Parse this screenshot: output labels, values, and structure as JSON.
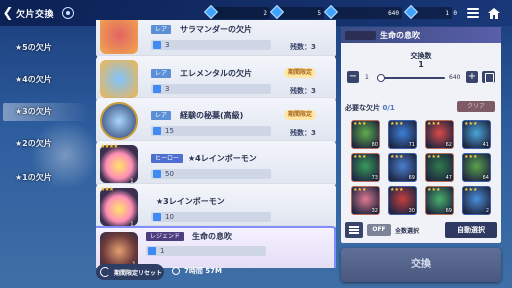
{
  "header": {
    "title": "欠片交換",
    "currencies": [
      "2",
      "5",
      "640",
      "1",
      "0"
    ]
  },
  "sidebar": {
    "items": [
      {
        "label": "★5の欠片",
        "active": false
      },
      {
        "label": "★4の欠片",
        "active": false
      },
      {
        "label": "★3の欠片",
        "active": true
      },
      {
        "label": "★2の欠片",
        "active": false
      },
      {
        "label": "★1の欠片",
        "active": false
      }
    ]
  },
  "list": {
    "items": [
      {
        "rarity": "レア",
        "name": "サラマンダーの欠片",
        "count": "3",
        "remain": "残数：3",
        "limited": ""
      },
      {
        "rarity": "レア",
        "name": "エレメンタルの欠片",
        "count": "3",
        "remain": "残数：3",
        "limited": "期間限定"
      },
      {
        "rarity": "レア",
        "name": "経験の秘薬(高級)",
        "count": "15",
        "remain": "残数：3",
        "limited": "期間限定"
      },
      {
        "rarity": "ヒーロー",
        "name": "★4レインボーモン",
        "count": "50",
        "remain": "",
        "limited": "",
        "qty": "1",
        "stars": "★★★★"
      },
      {
        "rarity": "",
        "name": "★3レインボーモン",
        "count": "10",
        "remain": "",
        "limited": "",
        "qty": "1",
        "stars": "★★★"
      },
      {
        "rarity": "レジェンド",
        "name": "生命の息吹",
        "count": "1",
        "remain": "",
        "limited": "",
        "qty": "1"
      }
    ]
  },
  "reset": {
    "label": "期間限定リセット",
    "timer": "7時間 57M"
  },
  "panel": {
    "badge": "レジェンド",
    "name": "生命の息吹",
    "qty_label": "交換数",
    "qty_value": "1",
    "min": "1",
    "max": "640",
    "slider_fraction": 0.0,
    "need_label": "必要な欠片",
    "need_count": "0/1",
    "clear": "クリア",
    "grid": [
      {
        "num": "80"
      },
      {
        "num": "71"
      },
      {
        "num": "62"
      },
      {
        "num": "41"
      },
      {
        "num": "73"
      },
      {
        "num": "69"
      },
      {
        "num": "47"
      },
      {
        "num": "64"
      },
      {
        "num": "32"
      },
      {
        "num": "30"
      },
      {
        "num": "69"
      },
      {
        "num": "2"
      }
    ],
    "toggle": "OFF",
    "all_select": "全数選択",
    "auto_select": "自動選択"
  },
  "exchange": {
    "label": "交換"
  }
}
